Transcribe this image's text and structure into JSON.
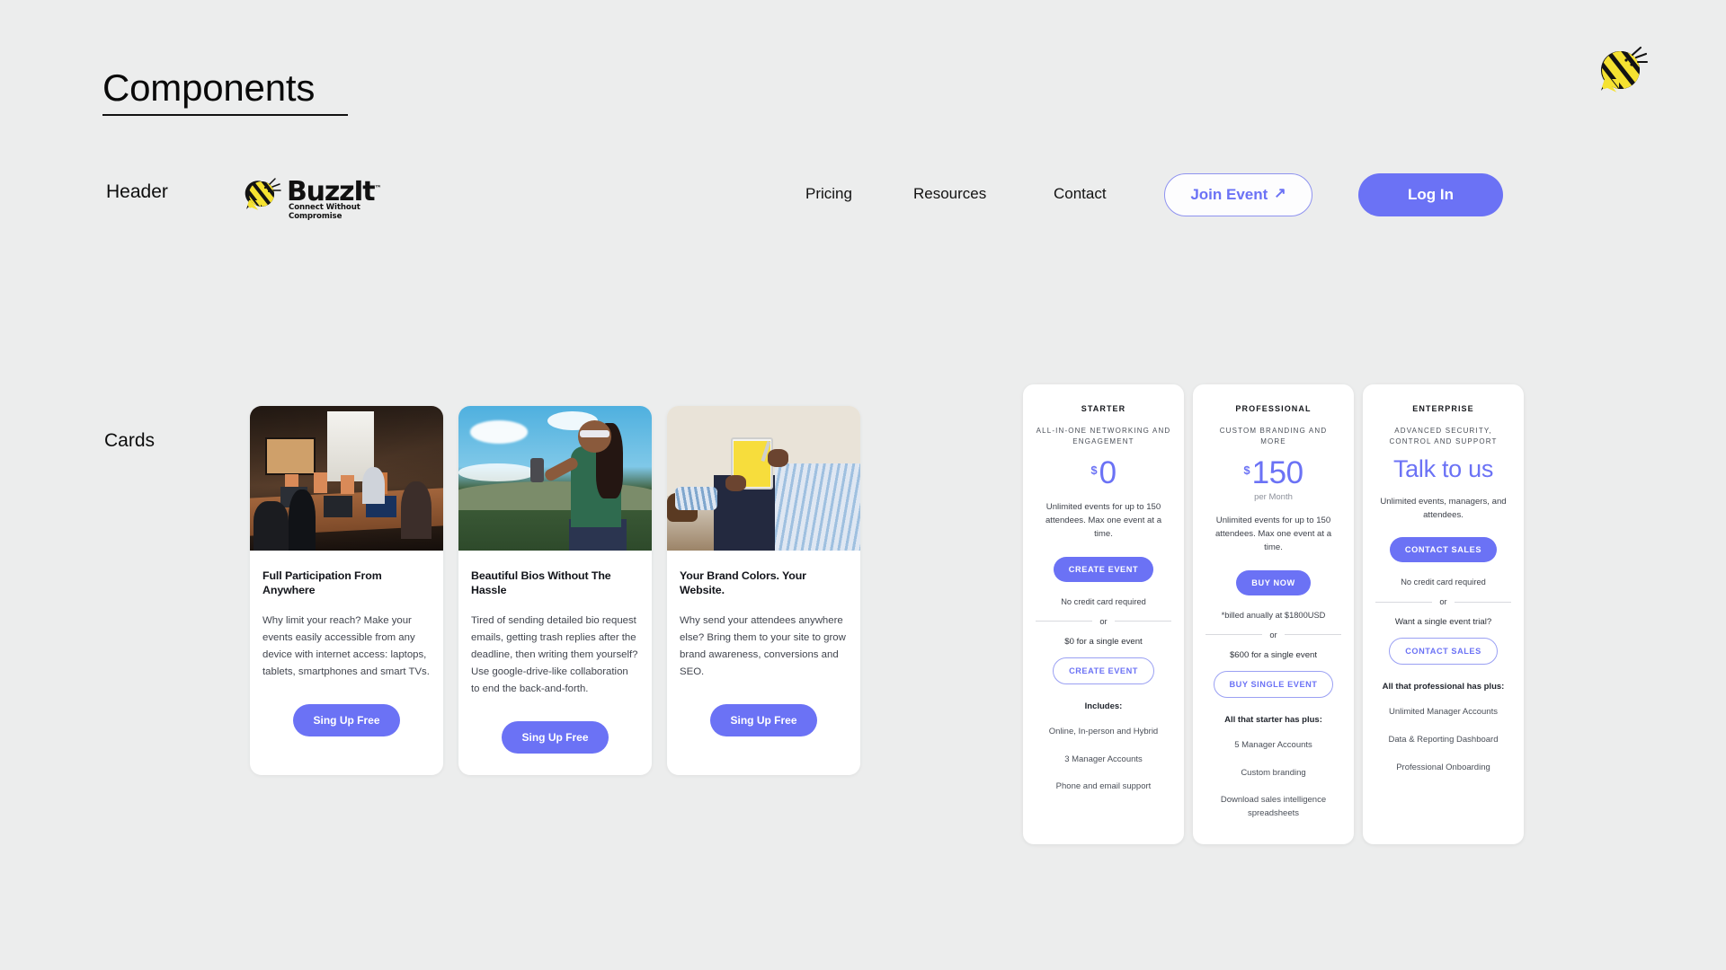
{
  "page": {
    "title": "Components",
    "bee_logo_icon": "bee-mascot-icon"
  },
  "sections": {
    "header_label": "Header",
    "cards_label": "Cards"
  },
  "colors": {
    "accent_purple": "#6B72F5",
    "page_background": "#ECEDED",
    "card_background": "#FFFFFF",
    "bee_yellow": "#F5E231",
    "text_dark": "#111111"
  },
  "header": {
    "brand": {
      "name": "BuzzIt",
      "trademark": "™",
      "tagline": "Connect Without Compromise",
      "icon": "bee-mascot-icon"
    },
    "nav": [
      {
        "label": "Pricing"
      },
      {
        "label": "Resources"
      },
      {
        "label": "Contact"
      }
    ],
    "join_button": {
      "label": "Join Event",
      "icon": "arrow-up-right-icon",
      "glyph": "↗"
    },
    "login_button": {
      "label": "Log In"
    }
  },
  "cards": [
    {
      "image": "conference-room-meeting-photo",
      "title": "Full Participation From Anywhere",
      "description": "Why limit your reach? Make your events easily accessible from any device with internet access: laptops, tablets, smartphones and smart TVs.",
      "button": "Sing Up Free"
    },
    {
      "image": "woman-with-phone-outdoors-photo",
      "title": "Beautiful Bios Without The Hassle",
      "description": "Tired of sending detailed bio request emails, getting trash replies after the deadline, then writing them yourself? Use google-drive-like collaboration to end the back-and-forth.",
      "button": "Sing Up Free"
    },
    {
      "image": "man-reading-tablet-photo",
      "title": "Your Brand Colors. Your Website.",
      "description": "Why send your attendees anywhere else? Bring them to your site to grow brand awareness, conversions and SEO.",
      "button": "Sing Up Free"
    }
  ],
  "pricing": [
    {
      "name": "STARTER",
      "subtitle": "ALL-IN-ONE NETWORKING AND ENGAGEMENT",
      "currency": "$",
      "amount": "0",
      "per": "",
      "blurb": "Unlimited events for up to 150 attendees. Max one event at a time.",
      "cta_primary": "CREATE EVENT",
      "note": "No credit card required",
      "or": "or",
      "alt_line": "$0 for a single event",
      "cta_secondary": "CREATE EVENT",
      "includes_label": "Includes:",
      "features": [
        "Online, In-person and Hybrid",
        "3 Manager Accounts",
        "Phone and email support"
      ]
    },
    {
      "name": "PROFESSIONAL",
      "subtitle": "CUSTOM BRANDING AND MORE",
      "currency": "$",
      "amount": "150",
      "per": "per Month",
      "blurb": "Unlimited events for up to 150 attendees. Max one event at a time.",
      "cta_primary": "BUY NOW",
      "note": "*billed anually at $1800USD",
      "or": "or",
      "alt_line": "$600 for a single event",
      "cta_secondary": "BUY SINGLE EVENT",
      "includes_label": "All that starter has plus:",
      "features": [
        "5 Manager Accounts",
        "Custom branding",
        "Download sales intelligence spreadsheets"
      ]
    },
    {
      "name": "ENTERPRISE",
      "subtitle": "ADVANCED SECURITY, CONTROL AND SUPPORT",
      "currency": "",
      "amount": "",
      "headline": "Talk to us",
      "per": "",
      "blurb": "Unlimited events, managers, and attendees.",
      "cta_primary": "CONTACT SALES",
      "note": "No credit card required",
      "or": "or",
      "alt_line": "Want a single event trial?",
      "cta_secondary": "CONTACT SALES",
      "includes_label": "All that professional has plus:",
      "features": [
        "Unlimited Manager Accounts",
        "Data & Reporting Dashboard",
        "Professional Onboarding"
      ]
    }
  ]
}
